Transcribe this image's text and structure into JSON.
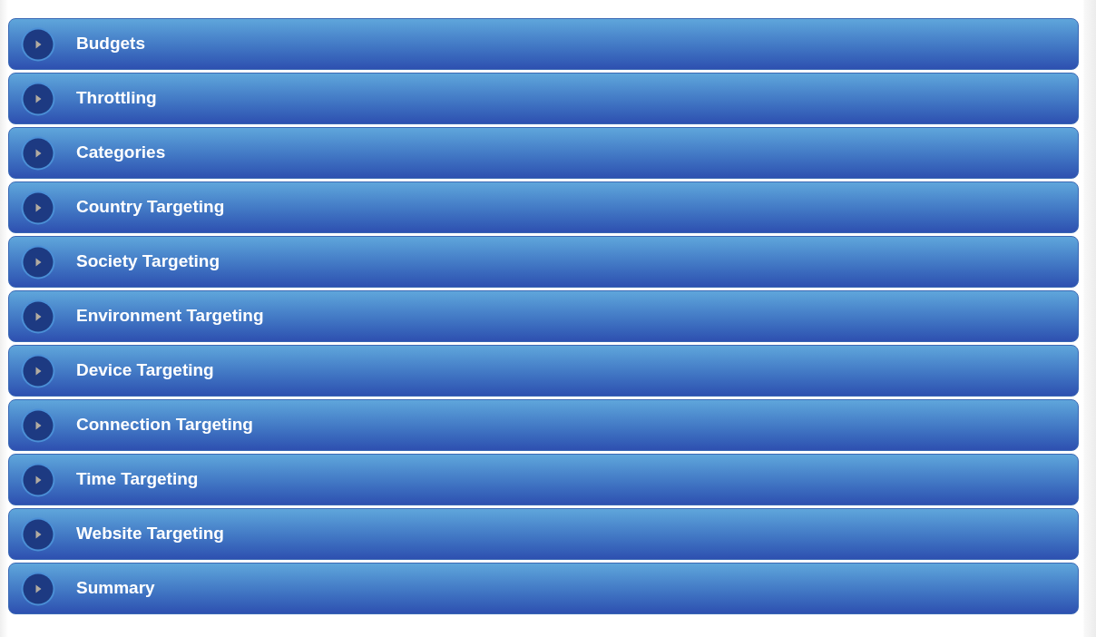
{
  "accordion": {
    "sections": [
      {
        "title": "Budgets",
        "expanded": false
      },
      {
        "title": "Throttling",
        "expanded": false
      },
      {
        "title": "Categories",
        "expanded": false
      },
      {
        "title": "Country Targeting",
        "expanded": false
      },
      {
        "title": "Society Targeting",
        "expanded": false
      },
      {
        "title": "Environment Targeting",
        "expanded": false
      },
      {
        "title": "Device Targeting",
        "expanded": false
      },
      {
        "title": "Connection Targeting",
        "expanded": false
      },
      {
        "title": "Time Targeting",
        "expanded": false
      },
      {
        "title": "Website Targeting",
        "expanded": false
      },
      {
        "title": "Summary",
        "expanded": false
      }
    ]
  }
}
